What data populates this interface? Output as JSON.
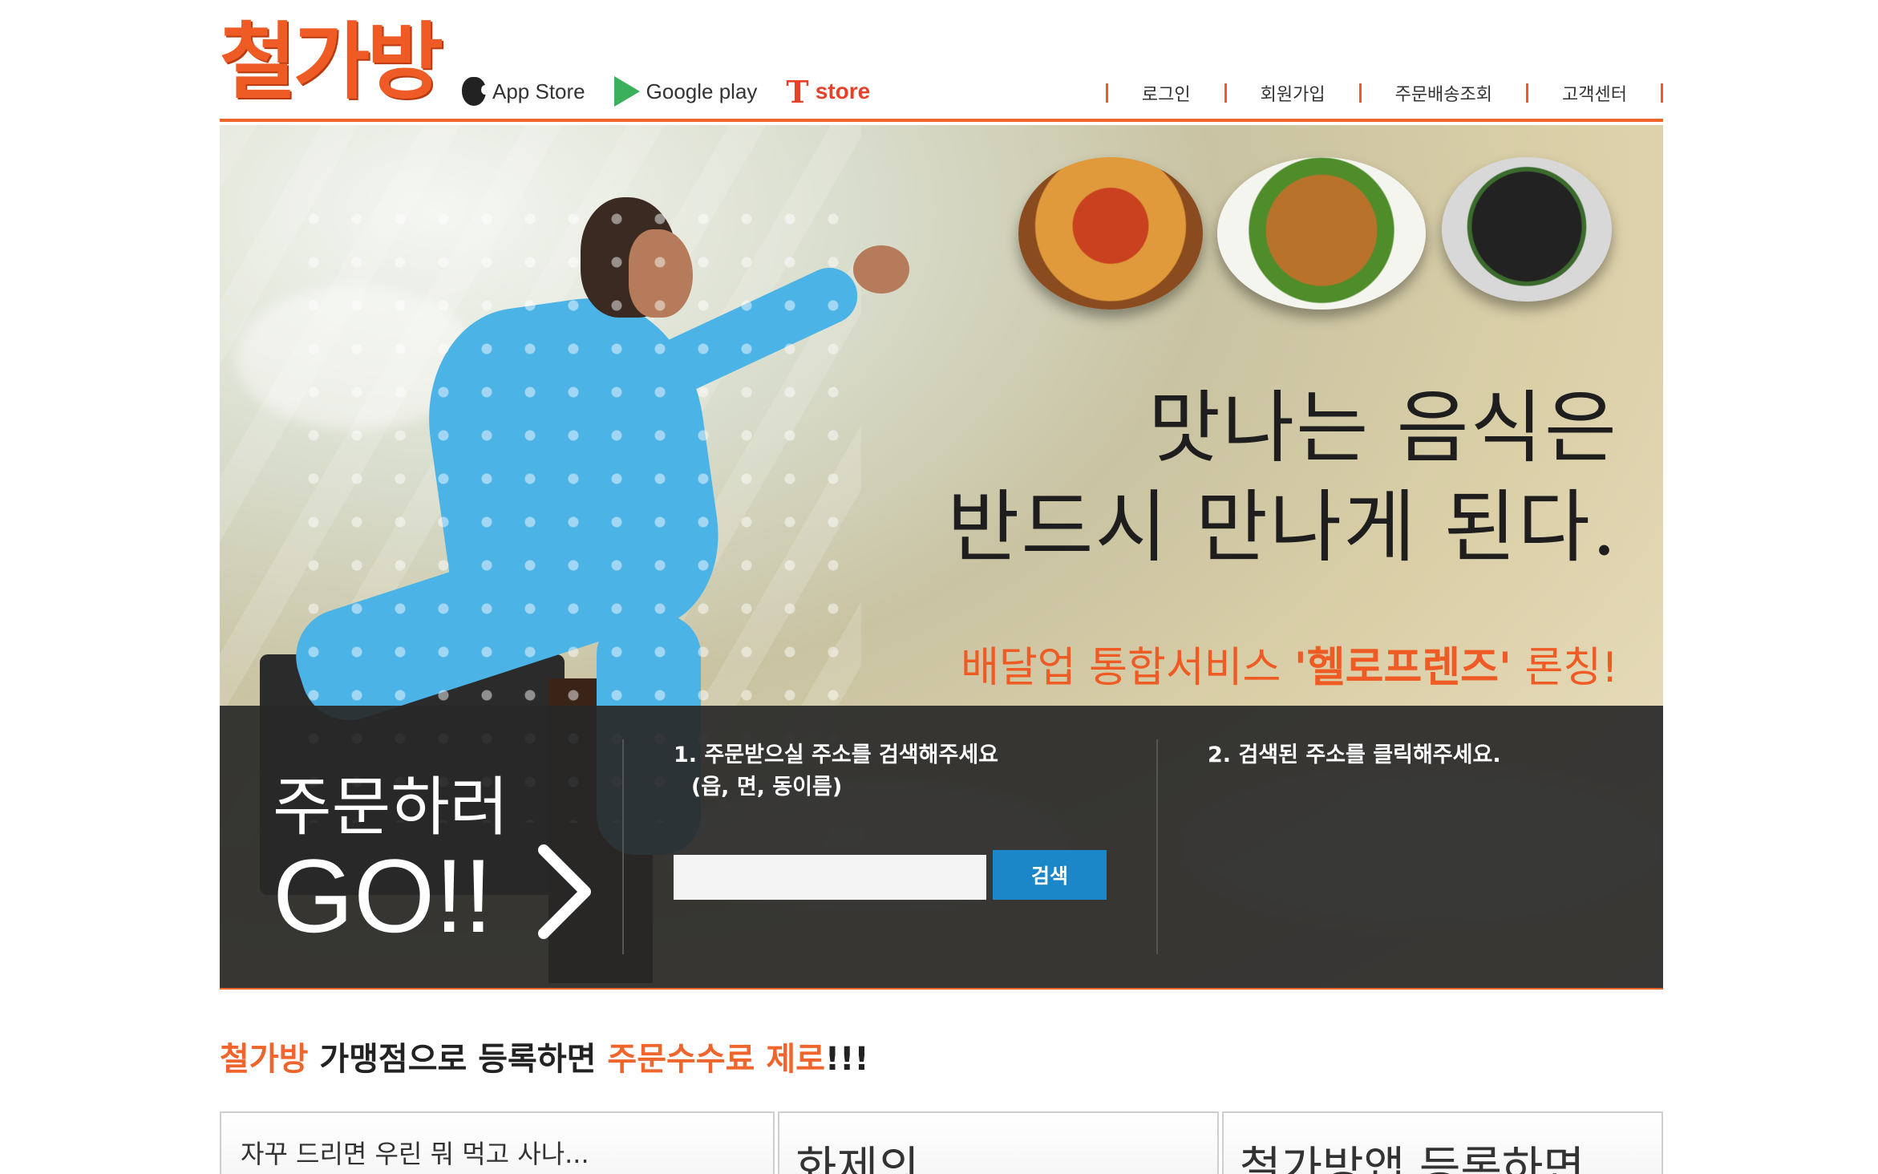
{
  "header": {
    "logo": "철가방",
    "stores": [
      {
        "name": "App Store",
        "icon": "apple-icon"
      },
      {
        "name": "Google play",
        "icon": "google-play-icon"
      },
      {
        "name": "store",
        "icon": "tstore-icon"
      }
    ],
    "nav": [
      "로그인",
      "회원가입",
      "주문배송조회",
      "고객센터"
    ]
  },
  "hero": {
    "slogan_line1": "맛나는 음식은",
    "slogan_line2": "반드시 만나게 된다.",
    "launch_prefix": "배달업 통합서비스 ",
    "launch_brand": "'헬로프렌즈'",
    "launch_suffix": " 론칭!"
  },
  "order": {
    "go_title": "주문하러",
    "go_big": "GO!!",
    "step1_line1": "1. 주문받으실 주소를 검색해주세요",
    "step1_line2": "(읍, 면, 동이름)",
    "address_value": "",
    "search_label": "검색",
    "step2": "2. 검색된 주소를 클릭해주세요."
  },
  "franchise": {
    "part1": "철가방",
    "part2": " 가맹점으로 등록하면 ",
    "part3": "주문수수료 제로",
    "part4": "!!!"
  },
  "cards": [
    {
      "text": "자꾸 드리면 우린 뭐 먹고 사나..."
    },
    {
      "text": "화제의"
    },
    {
      "text": "철가방앱 등록하면"
    }
  ],
  "colors": {
    "accent": "#f0652b",
    "search_button": "#1b86c8",
    "panel": "#282828"
  }
}
